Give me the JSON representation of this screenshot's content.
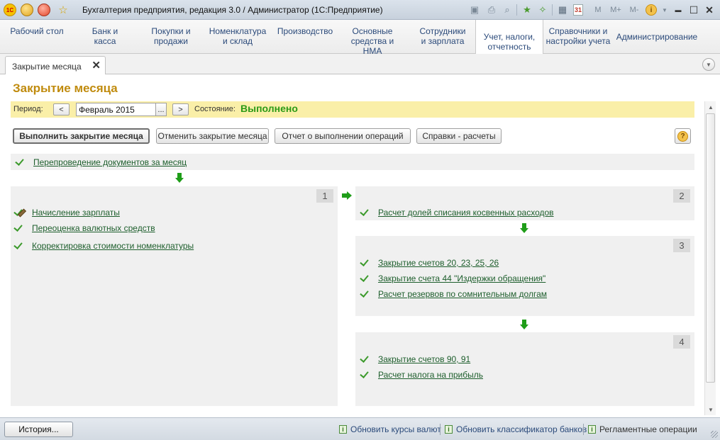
{
  "window": {
    "title": "Бухгалтерия предприятия, редакция 3.0 / Администратор  (1С:Предприятие)",
    "logo_text": "1С",
    "toolbar_icons": [
      "save-icon",
      "print-icon",
      "print-preview-icon",
      "favorites-add-icon",
      "bookmark-icon",
      "calculator-icon",
      "calendar-icon"
    ],
    "memory_buttons": [
      "M",
      "M+",
      "M-"
    ],
    "calendar_day": "31",
    "controls": {
      "minimize": "▬",
      "maximize": "☐",
      "close": "✕"
    }
  },
  "sections": [
    {
      "label": "Рабочий стол"
    },
    {
      "label": "Банк и касса"
    },
    {
      "label": "Покупки и продажи"
    },
    {
      "label": "Номенклатура и склад"
    },
    {
      "label": "Производство"
    },
    {
      "label": "Основные средства и НМА"
    },
    {
      "label": "Сотрудники и зарплата"
    },
    {
      "label": "Учет, налоги, отчетность",
      "active": true
    },
    {
      "label": "Справочники и настройки учета"
    },
    {
      "label": "Администрирование"
    }
  ],
  "open_tab": {
    "label": "Закрытие месяца",
    "close": "✕"
  },
  "form": {
    "title": "Закрытие месяца",
    "period_label": "Период:",
    "prev_label": "<",
    "period_value": "Февраль 2015",
    "select_label": "...",
    "next_label": ">",
    "state_label": "Состояние:",
    "state_value": "Выполнено",
    "state_color": "#2b9a16",
    "buttons": {
      "execute": "Выполнить закрытие месяца",
      "cancel": "Отменить закрытие месяца",
      "report": "Отчет о выполнении операций",
      "calc": "Справки - расчеты",
      "help": "?"
    },
    "repost": "Перепроведение документов за месяц",
    "stage1": {
      "number": "1",
      "ops": [
        "Начисление зарплаты",
        "Переоценка валютных средств",
        "Корректировка стоимости номенклатуры"
      ]
    },
    "stage2": {
      "number": "2",
      "ops": [
        "Расчет долей списания косвенных расходов"
      ]
    },
    "stage3": {
      "number": "3",
      "ops": [
        "Закрытие счетов 20, 23, 25, 26",
        "Закрытие счета 44 \"Издержки обращения\"",
        "Расчет резервов по сомнительным долгам"
      ]
    },
    "stage4": {
      "number": "4",
      "ops": [
        "Закрытие счетов 90, 91",
        "Расчет налога на прибыль"
      ]
    },
    "accent_color": "#c08b0e",
    "link_color": "#1d5e2c"
  },
  "statusbar": {
    "history": "История...",
    "links": [
      "Обновить курсы валют",
      "Обновить классификатор банков",
      "Регламентные операции"
    ],
    "info_icon": "i"
  }
}
